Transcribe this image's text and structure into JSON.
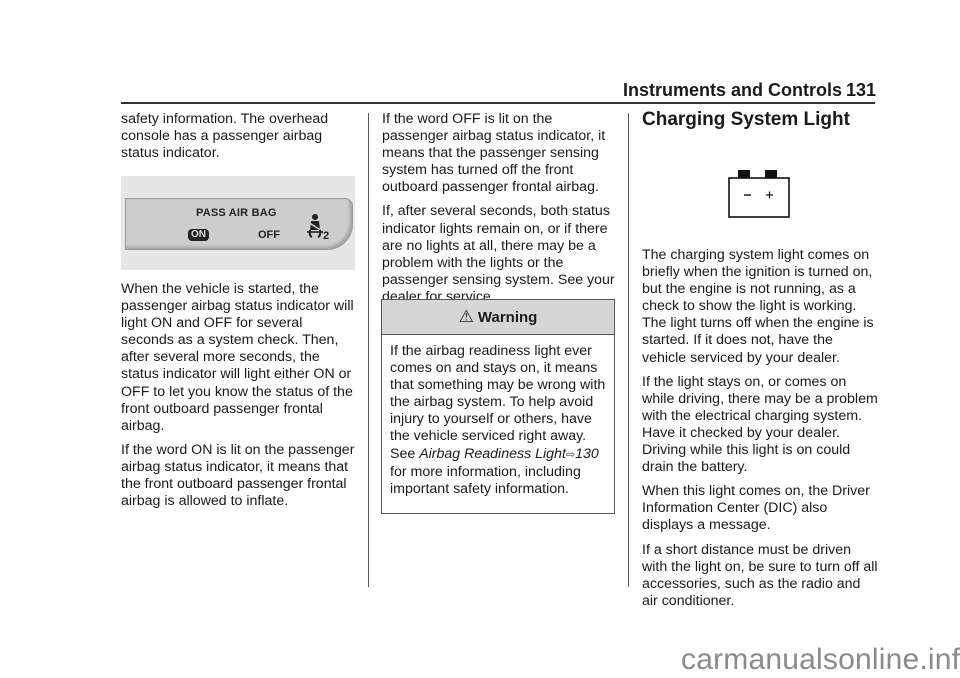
{
  "header": {
    "section_title": "Instruments and Controls",
    "page_number": "131"
  },
  "column1": {
    "para1": "safety information. The overhead console has a passenger airbag status indicator.",
    "figure": {
      "label": "PASS AIR BAG",
      "on_label": "ON",
      "off_label": "OFF",
      "icon_suffix": "2",
      "icon": "seatbelt-passenger-icon"
    },
    "para2": "When the vehicle is started, the passenger airbag status indicator will light ON and OFF for several seconds as a system check. Then, after several more seconds, the status indicator will light either ON or OFF to let you know the status of the front outboard passenger frontal airbag.",
    "para3": "If the word ON is lit on the passenger airbag status indicator, it means that the front outboard passenger frontal airbag is allowed to inflate."
  },
  "column2": {
    "para1": "If the word OFF is lit on the passenger airbag status indicator, it means that the passenger sensing system has turned off the front outboard passenger frontal airbag.",
    "para2": "If, after several seconds, both status indicator lights remain on, or if there are no lights at all, there may be a problem with the lights or the passenger sensing system. See your dealer for service.",
    "warning": {
      "icon": "warning-triangle-icon",
      "icon_glyph": "⚠",
      "title": "Warning",
      "body_before": "If the airbag readiness light ever comes on and stays on, it means that something may be wrong with the airbag system. To help avoid injury to yourself or others, have the vehicle serviced right away. See ",
      "link_text": "Airbag Readiness Light",
      "link_arrow": "⇨",
      "link_page": "130",
      "body_after": " for more information, including important safety information."
    }
  },
  "column3": {
    "heading": "Charging System Light",
    "icon": "battery-icon",
    "para1": "The charging system light comes on briefly when the ignition is turned on, but the engine is not running, as a check to show the light is working. The light turns off when the engine is started. If it does not, have the vehicle serviced by your dealer.",
    "para2": "If the light stays on, or comes on while driving, there may be a problem with the electrical charging system. Have it checked by your dealer. Driving while this light is on could drain the battery.",
    "para3": "When this light comes on, the Driver Information Center (DIC) also displays a message.",
    "para4": "If a short distance must be driven with the light on, be sure to turn off all accessories, such as the radio and air conditioner."
  },
  "watermark": "carmanualsonline.info"
}
